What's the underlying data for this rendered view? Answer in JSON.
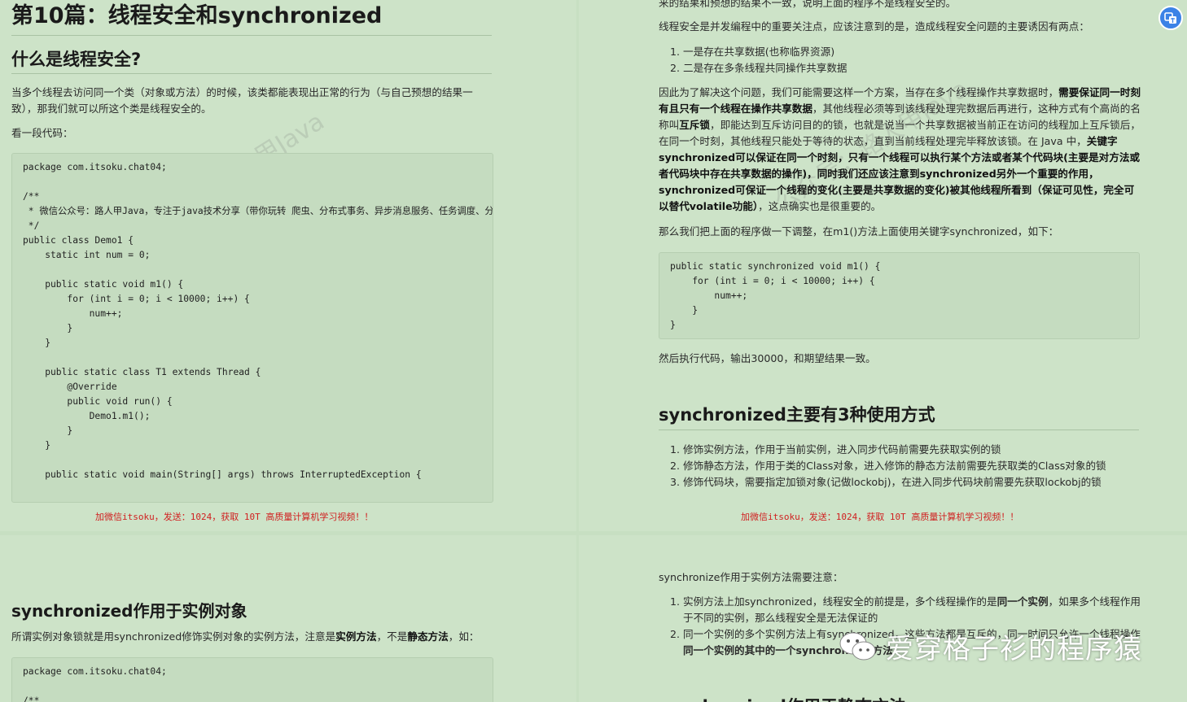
{
  "p1": {
    "title": "第10篇：线程安全和synchronized",
    "h_what": "什么是线程安全?",
    "para1": "当多个线程去访问同一个类（对象或方法）的时候，该类都能表现出正常的行为（与自己预想的结果一致），那我们就可以所这个类是线程安全的。",
    "para2": "看一段代码：",
    "code": {
      "l1": "package com.itsoku.chat04;",
      "l2": "/**",
      "l3": " * 微信公众号：路人甲Java，专注于java技术分享（带你玩转 爬虫、分布式事务、异步消息服务、任务调度、分库分表、大数据等），喜欢请关注！",
      "l4": " */",
      "l5": "public class Demo1 {",
      "l6": "    static int num = 0;",
      "l7": "    public static void m1() {",
      "l8": "        for (int i = 0; i < 10000; i++) {",
      "l9": "            num++;",
      "l10": "        }",
      "l11": "    }",
      "l12": "    public static class T1 extends Thread {",
      "l13": "        @Override",
      "l14": "        public void run() {",
      "l15": "            Demo1.m1();",
      "l16": "        }",
      "l17": "    }",
      "l18": "    public static void main(String[] args) throws InterruptedException {"
    },
    "footer": "加微信itsoku，发送：1024，获取 10T 高质量计算机学习视频！！",
    "watermark": "公众号：路人甲Java"
  },
  "p2": {
    "top_fragment": "来的结果和预想的结果不一致，说明上面的程序不是线程安全的。",
    "para1": "线程安全是并发编程中的重要关注点，应该注意到的是，造成线程安全问题的主要诱因有两点：",
    "list1": [
      "一是存在共享数据(也称临界资源)",
      "二是存在多条线程共同操作共享数据"
    ],
    "para2_a": "因此为了解决这个问题，我们可能需要这样一个方案，当存在多个线程操作共享数据时，",
    "para2_b": "需要保证同一时刻有且只有一个线程在操作共享数据",
    "para2_c": "，其他线程必须等到该线程处理完数据后再进行，这种方式有个高尚的名称叫",
    "para2_d": "互斥锁",
    "para2_e": "，即能达到互斥访问目的的锁，也就是说当一个共享数据被当前正在访问的线程加上互斥锁后，在同一个时刻，其他线程只能处于等待的状态，直到当前线程处理完毕释放该锁。在 Java 中，",
    "para2_f": "关键字 synchronized可以保证在同一个时刻，只有一个线程可以执行某个方法或者某个代码块(主要是对方法或者代码块中存在共享数据的操作)，同时我们还应该注意到synchronized另外一个重要的作用，synchronized可保证一个线程的变化(主要是共享数据的变化)被其他线程所看到（保证可见性，完全可以替代volatile功能）",
    "para2_g": "，这点确实也是很重要的。",
    "para3": "那么我们把上面的程序做一下调整，在m1()方法上面使用关键字synchronized，如下：",
    "code": {
      "l1": "public static synchronized void m1() {",
      "l2": "    for (int i = 0; i < 10000; i++) {",
      "l3": "        num++;",
      "l4": "    }",
      "l5": "}"
    },
    "para4": "然后执行代码，输出30000，和期望结果一致。",
    "h_usage": "synchronized主要有3种使用方式",
    "list2": [
      "修饰实例方法，作用于当前实例，进入同步代码前需要先获取实例的锁",
      "修饰静态方法，作用于类的Class对象，进入修饰的静态方法前需要先获取类的Class对象的锁",
      "修饰代码块，需要指定加锁对象(记做lockobj)，在进入同步代码块前需要先获取lockobj的锁"
    ],
    "footer": "加微信itsoku，发送：1024，获取 10T 高质量计算机学习视频！！",
    "watermark": "公众号：路人甲Java"
  },
  "p3": {
    "h_instance": "synchronized作用于实例对象",
    "para_a": "所谓实例对象锁就是用synchronized修饰实例对象的实例方法，注意是",
    "para_b": "实例方法",
    "para_c": "，不是",
    "para_d": "静态方法",
    "para_e": "，如：",
    "code_l1": "package com.itsoku.chat04;",
    "code_l2": "/**"
  },
  "p4": {
    "para1": "synchronize作用于实例方法需要注意：",
    "item1": "实例方法上加synchronized，线程安全的前提是，多个线程操作的是",
    "item1_b": "同一个实例",
    "item1_c": "，如果多个线程作用于不同的实例，那么线程安全是无法保证的",
    "item2": "同一个实例的多个实例方法上有synchronized，这些方法都是互斥的，同一时间只允许一个线程操作",
    "item2_b": "同一个实例的其中的一个synchronized方法",
    "h_next": "synchronized作用于静态方法"
  },
  "overlay": {
    "brand_text": "爱穿格子衫的程序猿",
    "brand_icon": "wechat-icon",
    "float_icon": "translate-icon"
  }
}
